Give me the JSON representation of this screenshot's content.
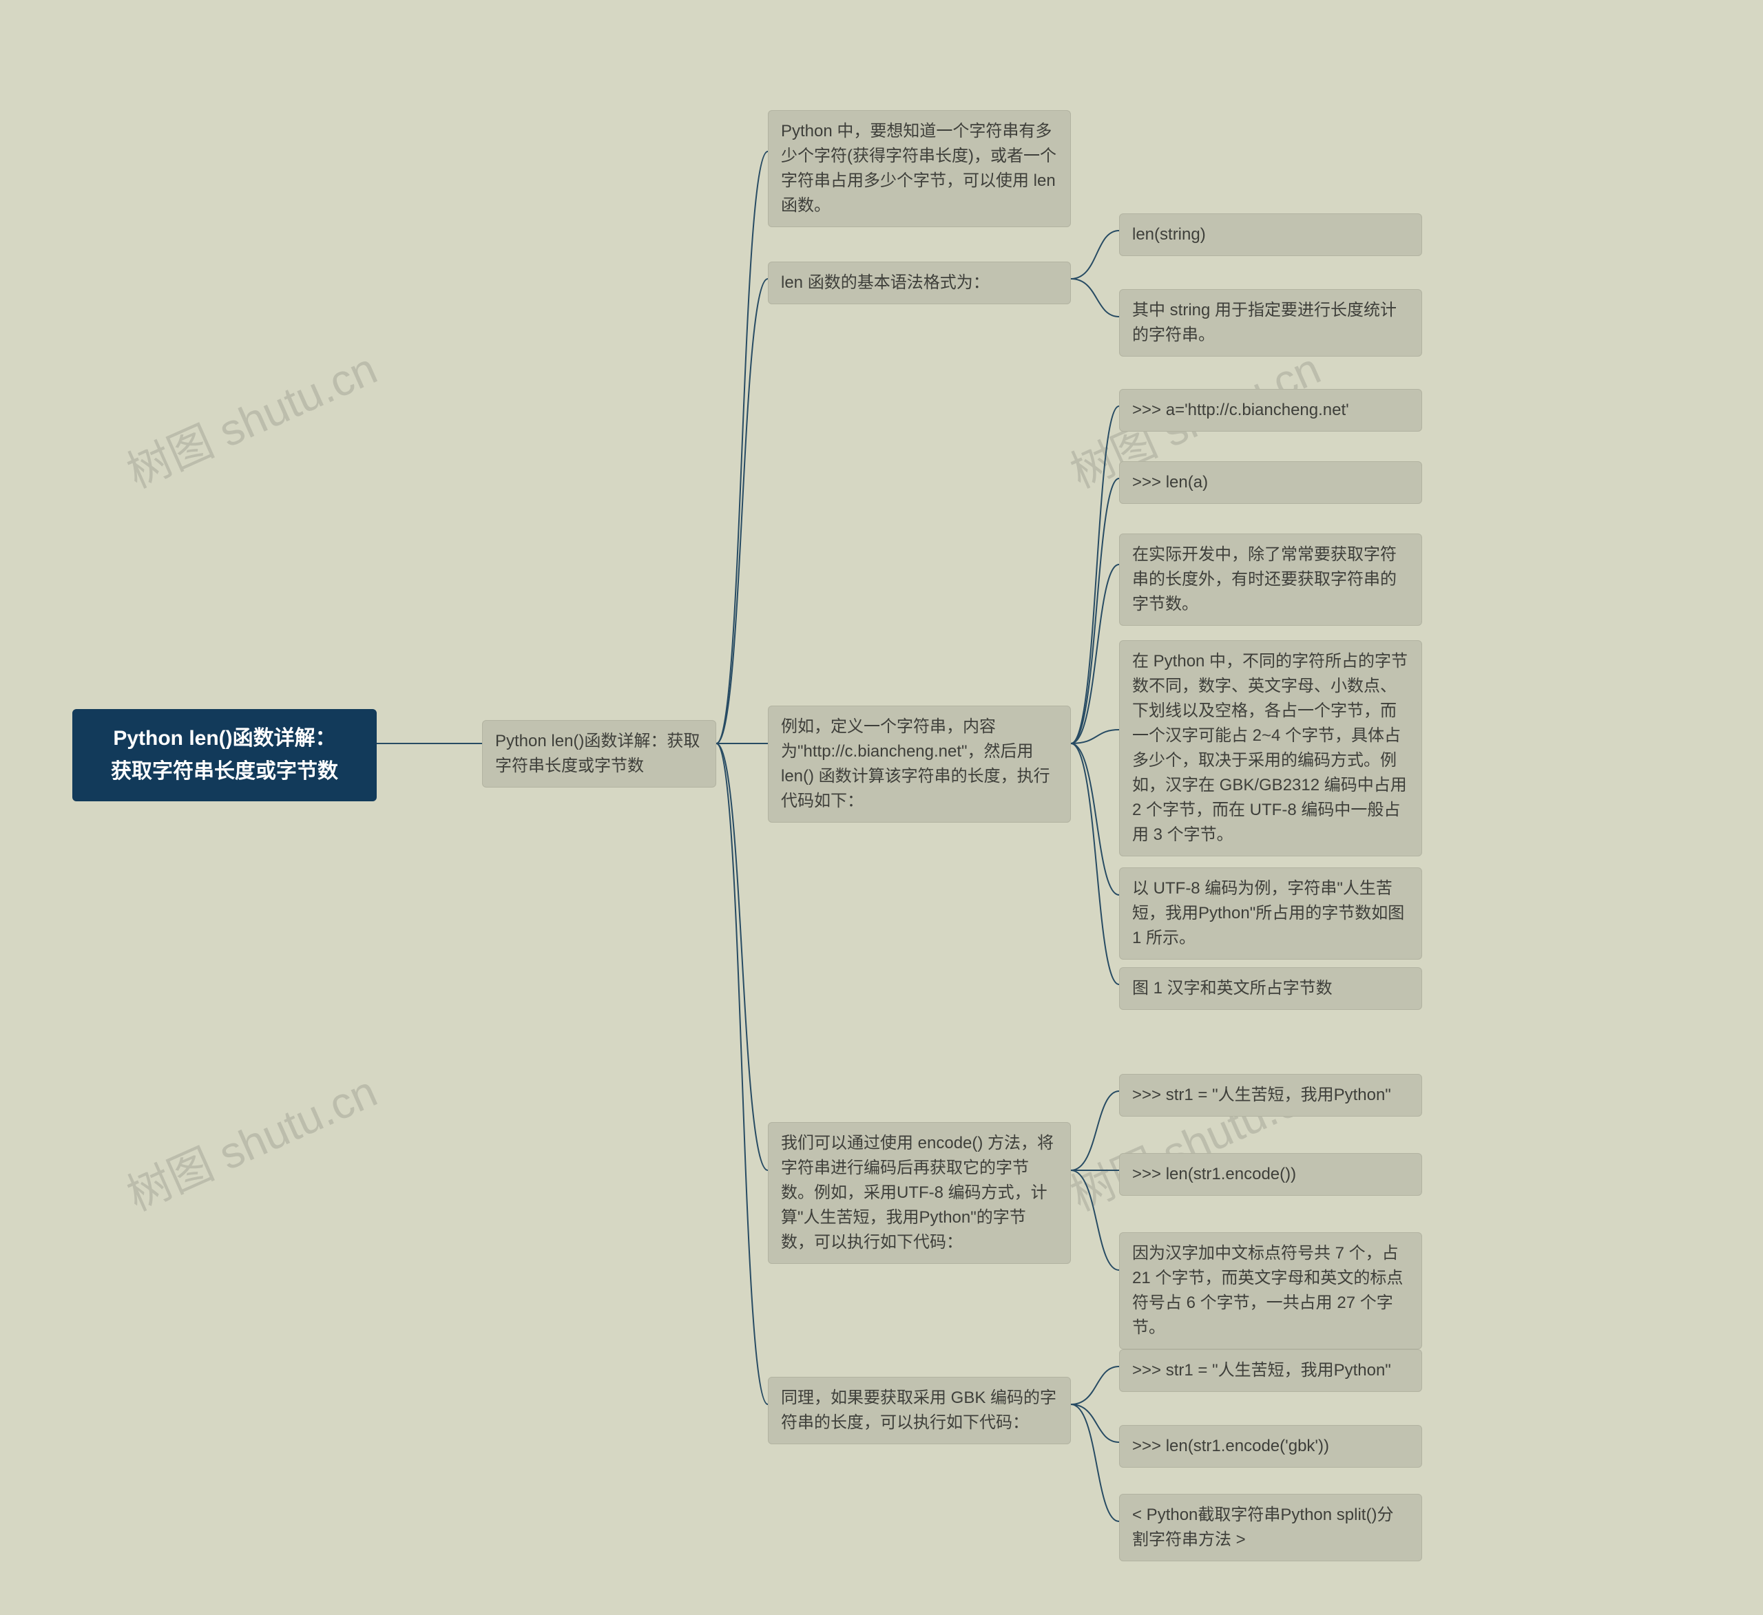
{
  "root": {
    "line1": "Python len()函数详解：",
    "line2": "获取字符串长度或字节数"
  },
  "level2": "Python len()函数详解：获取字符串长度或字节数",
  "branches": {
    "b1": "Python 中，要想知道一个字符串有多少个字符(获得字符串长度)，或者一个字符串占用多少个字节，可以使用 len 函数。",
    "b2": "len 函数的基本语法格式为：",
    "b3": "例如，定义一个字符串，内容为\"http://c.biancheng.net\"，然后用 len() 函数计算该字符串的长度，执行代码如下：",
    "b4": "我们可以通过使用 encode() 方法，将字符串进行编码后再获取它的字节数。例如，采用UTF-8 编码方式，计算\"人生苦短，我用Python\"的字节数，可以执行如下代码：",
    "b5": "同理，如果要获取采用 GBK 编码的字符串的长度，可以执行如下代码："
  },
  "leaves": {
    "b2_1": "len(string)",
    "b2_2": "其中 string 用于指定要进行长度统计的字符串。",
    "b3_1": ">>> a='http://c.biancheng.net'",
    "b3_2": ">>> len(a)",
    "b3_3": "在实际开发中，除了常常要获取字符串的长度外，有时还要获取字符串的字节数。",
    "b3_4": "在 Python 中，不同的字符所占的字节数不同，数字、英文字母、小数点、下划线以及空格，各占一个字节，而一个汉字可能占 2~4 个字节，具体占多少个，取决于采用的编码方式。例如，汉字在 GBK/GB2312 编码中占用 2 个字节，而在 UTF-8 编码中一般占用 3 个字节。",
    "b3_5": "以 UTF-8 编码为例，字符串\"人生苦短，我用Python\"所占用的字节数如图 1 所示。",
    "b3_6": "图 1 汉字和英文所占字节数",
    "b4_1": ">>> str1 = \"人生苦短，我用Python\"",
    "b4_2": ">>> len(str1.encode())",
    "b4_3": "因为汉字加中文标点符号共 7 个，占 21 个字节，而英文字母和英文的标点符号占 6 个字节，一共占用 27 个字节。",
    "b5_1": ">>> str1 = \"人生苦短，我用Python\"",
    "b5_2": ">>> len(str1.encode('gbk'))",
    "b5_3": "< Python截取字符串Python split()分割字符串方法 >"
  },
  "watermark": "树图 shutu.cn"
}
